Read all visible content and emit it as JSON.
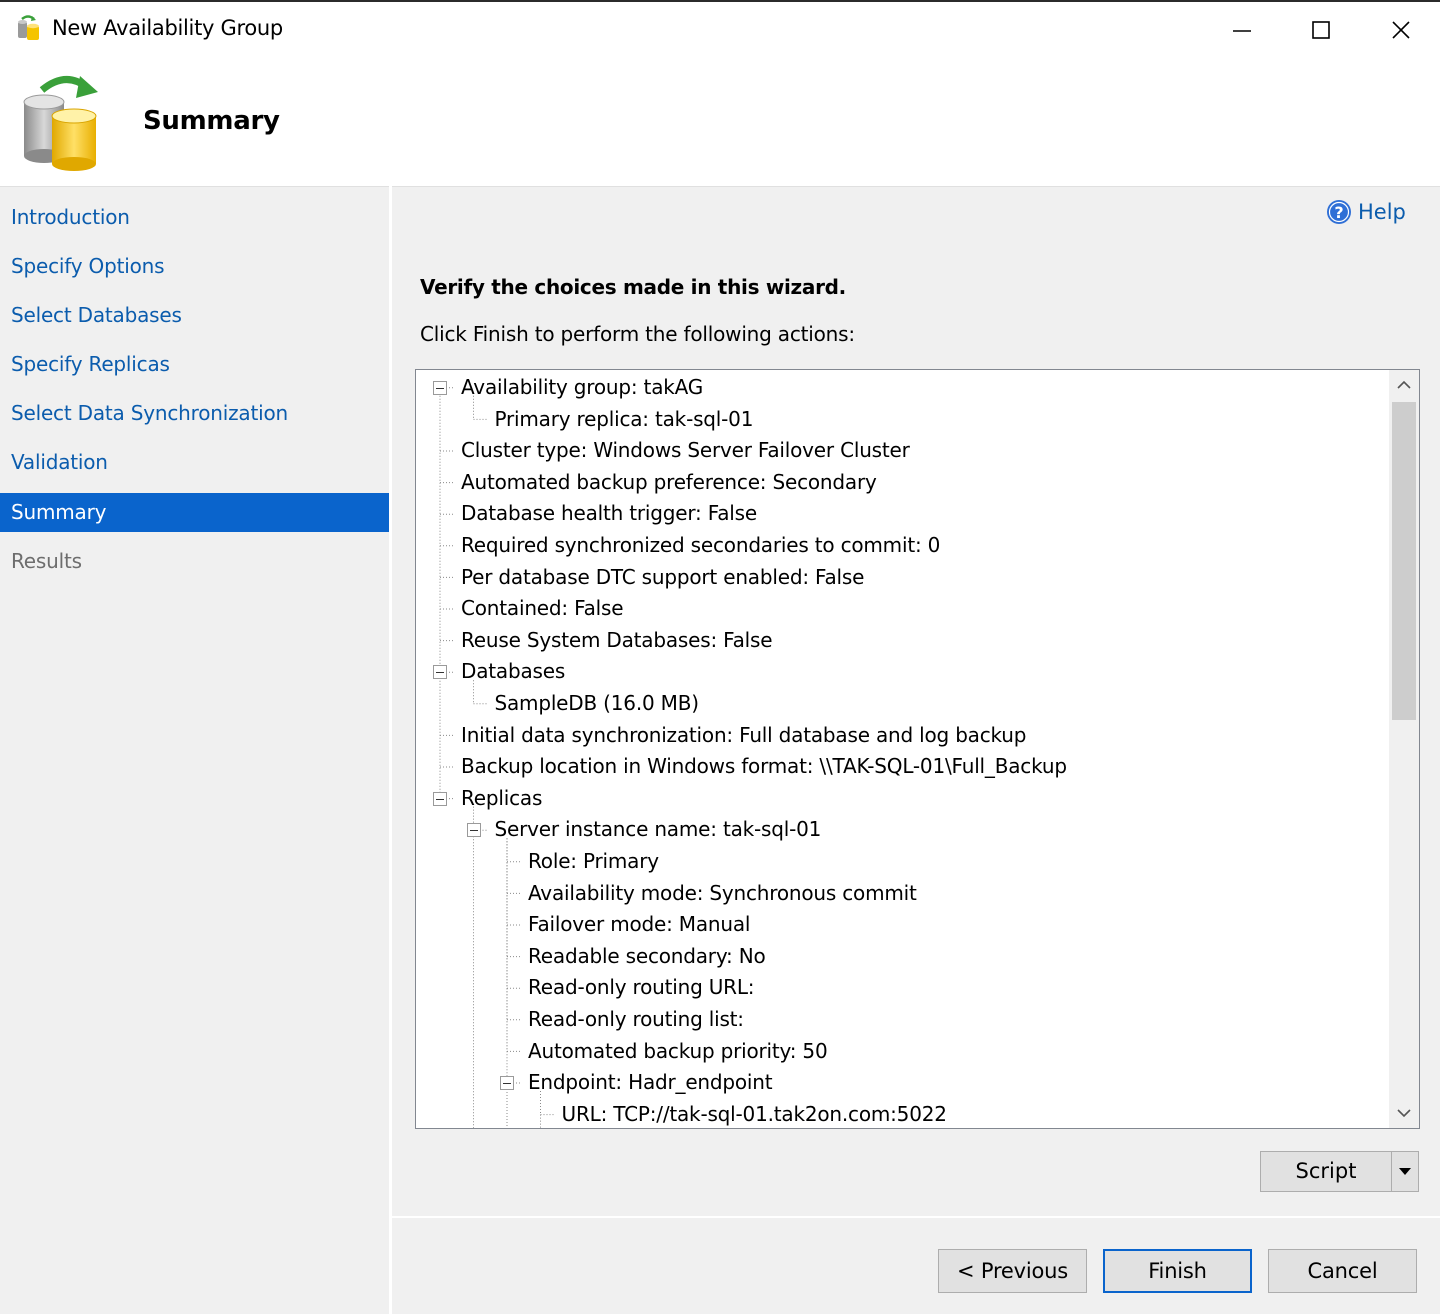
{
  "window": {
    "title": "New Availability Group"
  },
  "header": {
    "title": "Summary"
  },
  "nav": {
    "items": [
      {
        "label": "Introduction",
        "state": "link"
      },
      {
        "label": "Specify Options",
        "state": "link"
      },
      {
        "label": "Select Databases",
        "state": "link"
      },
      {
        "label": "Specify Replicas",
        "state": "link"
      },
      {
        "label": "Select Data Synchronization",
        "state": "link"
      },
      {
        "label": "Validation",
        "state": "link"
      },
      {
        "label": "Summary",
        "state": "active"
      },
      {
        "label": "Results",
        "state": "disabled"
      }
    ]
  },
  "main": {
    "help_label": "Help",
    "verify_text": "Verify the choices made in this wizard.",
    "instruction_text": "Click Finish to perform the following actions:",
    "tree": [
      {
        "level": 0,
        "text": "Availability group: takAG",
        "expander": true
      },
      {
        "level": 1,
        "text": "Primary replica: tak-sql-01",
        "expander": false
      },
      {
        "level": 0,
        "text": "Cluster type: Windows Server Failover Cluster",
        "expander": false
      },
      {
        "level": 0,
        "text": "Automated backup preference: Secondary",
        "expander": false
      },
      {
        "level": 0,
        "text": "Database health trigger: False",
        "expander": false
      },
      {
        "level": 0,
        "text": "Required synchronized secondaries to commit: 0",
        "expander": false
      },
      {
        "level": 0,
        "text": "Per database DTC support enabled: False",
        "expander": false
      },
      {
        "level": 0,
        "text": "Contained: False",
        "expander": false
      },
      {
        "level": 0,
        "text": "Reuse System Databases: False",
        "expander": false
      },
      {
        "level": 0,
        "text": "Databases",
        "expander": true
      },
      {
        "level": 1,
        "text": "SampleDB (16.0 MB)",
        "expander": false
      },
      {
        "level": 0,
        "text": "Initial data synchronization: Full database and log backup",
        "expander": false
      },
      {
        "level": 0,
        "text": "Backup location in Windows format: \\\\TAK-SQL-01\\Full_Backup",
        "expander": false
      },
      {
        "level": 0,
        "text": "Replicas",
        "expander": true
      },
      {
        "level": 1,
        "text": "Server instance name: tak-sql-01",
        "expander": true
      },
      {
        "level": 2,
        "text": "Role: Primary",
        "expander": false
      },
      {
        "level": 2,
        "text": "Availability mode: Synchronous commit",
        "expander": false
      },
      {
        "level": 2,
        "text": "Failover mode: Manual",
        "expander": false
      },
      {
        "level": 2,
        "text": "Readable secondary: No",
        "expander": false
      },
      {
        "level": 2,
        "text": "Read-only routing URL:",
        "expander": false
      },
      {
        "level": 2,
        "text": "Read-only routing list:",
        "expander": false
      },
      {
        "level": 2,
        "text": "Automated backup priority: 50",
        "expander": false
      },
      {
        "level": 2,
        "text": "Endpoint: Hadr_endpoint",
        "expander": true
      },
      {
        "level": 3,
        "text": "URL: TCP://tak-sql-01.tak2on.com:5022",
        "expander": false
      }
    ],
    "script_label": "Script"
  },
  "footer": {
    "previous_label": "< Previous",
    "finish_label": "Finish",
    "cancel_label": "Cancel"
  },
  "colors": {
    "accent": "#0a64cc",
    "link": "#0b5cad",
    "panel": "#f0f0f0"
  }
}
